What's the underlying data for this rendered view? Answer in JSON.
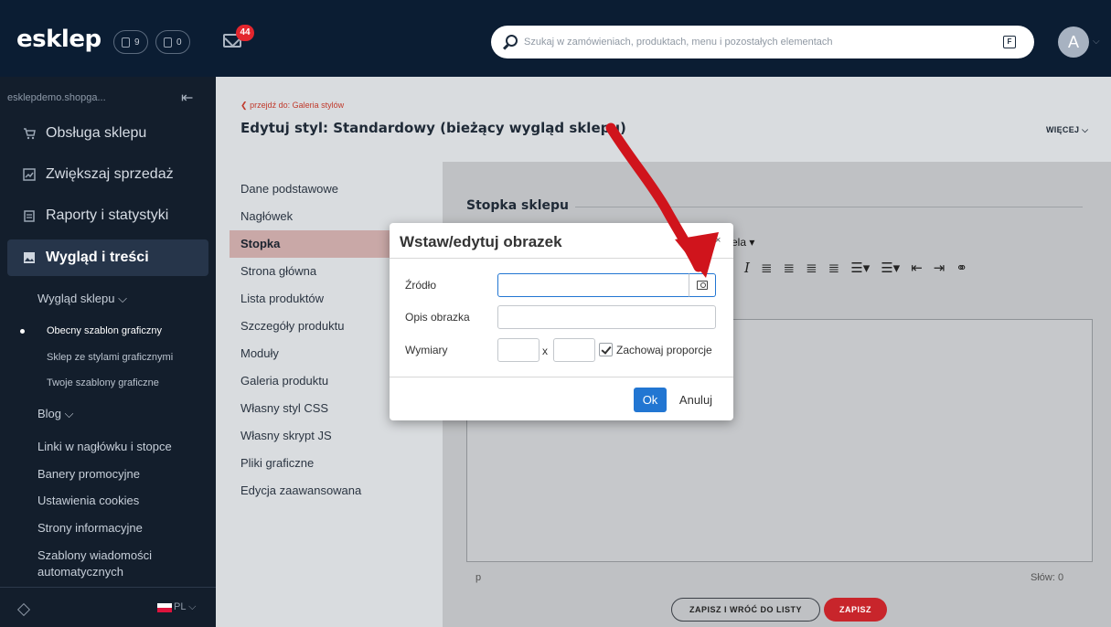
{
  "topbar": {
    "logo": "esklep",
    "orders_count": "9",
    "pending_count": "0",
    "mail_count": "44",
    "search_placeholder": "Szukaj w zamówieniach, produktach, menu i pozostałych elementach",
    "shortcut_key": "F",
    "avatar_letter": "A"
  },
  "sidebar": {
    "domain": "esklepdemo.shopga...",
    "main_items": [
      {
        "label": "Obsługa sklepu",
        "icon": "cart-icon"
      },
      {
        "label": "Zwiększaj sprzedaż",
        "icon": "chart-icon"
      },
      {
        "label": "Raporty i statystyki",
        "icon": "report-icon"
      },
      {
        "label": "Wygląd i treści",
        "icon": "image-icon"
      }
    ],
    "sub_group": "Wygląd sklepu",
    "sub_sub_items": [
      "Obecny szablon graficzny",
      "Sklep ze stylami graficznymi",
      "Twoje szablony graficzne"
    ],
    "blog": "Blog",
    "items": [
      "Linki w nagłówku i stopce",
      "Banery promocyjne",
      "Ustawienia cookies",
      "Strony informacyjne",
      "Szablony wiadomości automatycznych"
    ],
    "language": "PL"
  },
  "header": {
    "back_link": "przejdź do: Galeria stylów",
    "title": "Edytuj styl: Standardowy (bieżący wygląd sklepu)",
    "more": "WIĘCEJ"
  },
  "tabs": [
    "Dane podstawowe",
    "Nagłówek",
    "Stopka",
    "Strona główna",
    "Lista produktów",
    "Szczegóły produktu",
    "Moduły",
    "Galeria produktu",
    "Własny styl CSS",
    "Własny skrypt JS",
    "Pliki graficzne",
    "Edycja zaawansowana"
  ],
  "editor": {
    "section_title": "Stopka sklepu",
    "format_menu": "ela ▾",
    "status_path": "p",
    "word_count": "Słów: 0"
  },
  "actions": {
    "save_and_back": "ZAPISZ I WRÓĆ DO LISTY",
    "save": "ZAPISZ"
  },
  "dialog": {
    "title": "Wstaw/edytuj obrazek",
    "close": "×",
    "source_label": "Źródło",
    "source_value": "",
    "description_label": "Opis obrazka",
    "description_value": "",
    "dimensions_label": "Wymiary",
    "width_value": "",
    "height_value": "",
    "x": "x",
    "keep_proportions": "Zachowaj proporcje",
    "ok": "Ok",
    "cancel": "Anuluj"
  },
  "colors": {
    "topbar": "#0b1d33",
    "sidebar": "#131e2c",
    "accent_red": "#c8252b",
    "primary_blue": "#2276d2",
    "annotation_arrow": "#d0141c"
  }
}
